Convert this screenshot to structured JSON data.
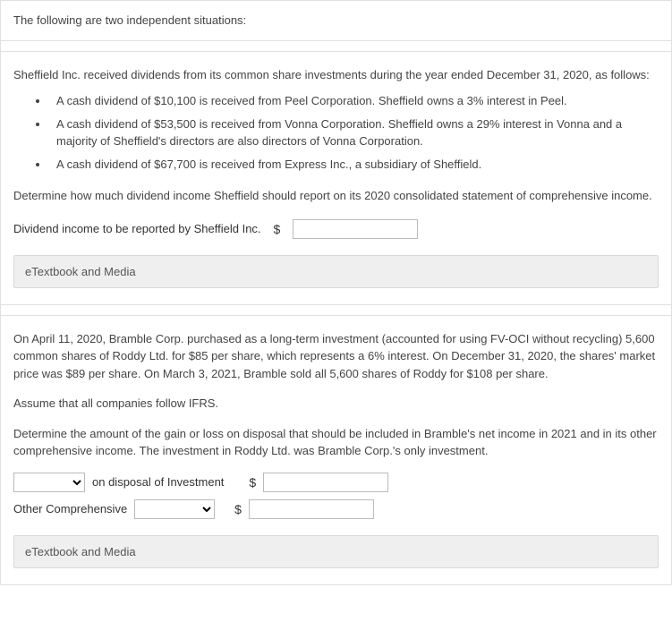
{
  "intro": "The following are two independent situations:",
  "situation1": {
    "lead": "Sheffield Inc. received dividends from its common share investments during the year ended December 31, 2020, as follows:",
    "bullets": [
      "A cash dividend of $10,100 is received from Peel Corporation. Sheffield owns a 3% interest in Peel.",
      "A cash dividend of $53,500 is received from Vonna Corporation. Sheffield owns a 29% interest in Vonna and a majority of Sheffield's directors are also directors of Vonna Corporation.",
      "A cash dividend of $67,700 is received from Express Inc., a subsidiary of Sheffield."
    ],
    "question": "Determine how much dividend income Sheffield should report on its 2020 consolidated statement of comprehensive income.",
    "input_label": "Dividend income to be reported by Sheffield Inc.",
    "currency": "$",
    "media_label": "eTextbook and Media"
  },
  "situation2": {
    "para1": "On April 11, 2020, Bramble Corp. purchased as a long-term investment (accounted for using FV-OCI without recycling) 5,600 common shares of Roddy Ltd. for $85 per share, which represents a 6% interest. On December 31, 2020, the shares' market price was $89 per share. On March 3, 2021, Bramble sold all 5,600 shares of Roddy for $108 per share.",
    "para2": "Assume that all companies follow IFRS.",
    "question": "Determine the amount of the gain or loss on disposal that should be included in Bramble's net income in 2021 and in its other comprehensive income. The investment in Roddy Ltd. was Bramble Corp.'s only investment.",
    "row1_suffix": "on disposal of Investment",
    "row2_prefix": "Other Comprehensive",
    "currency": "$",
    "media_label": "eTextbook and Media"
  }
}
